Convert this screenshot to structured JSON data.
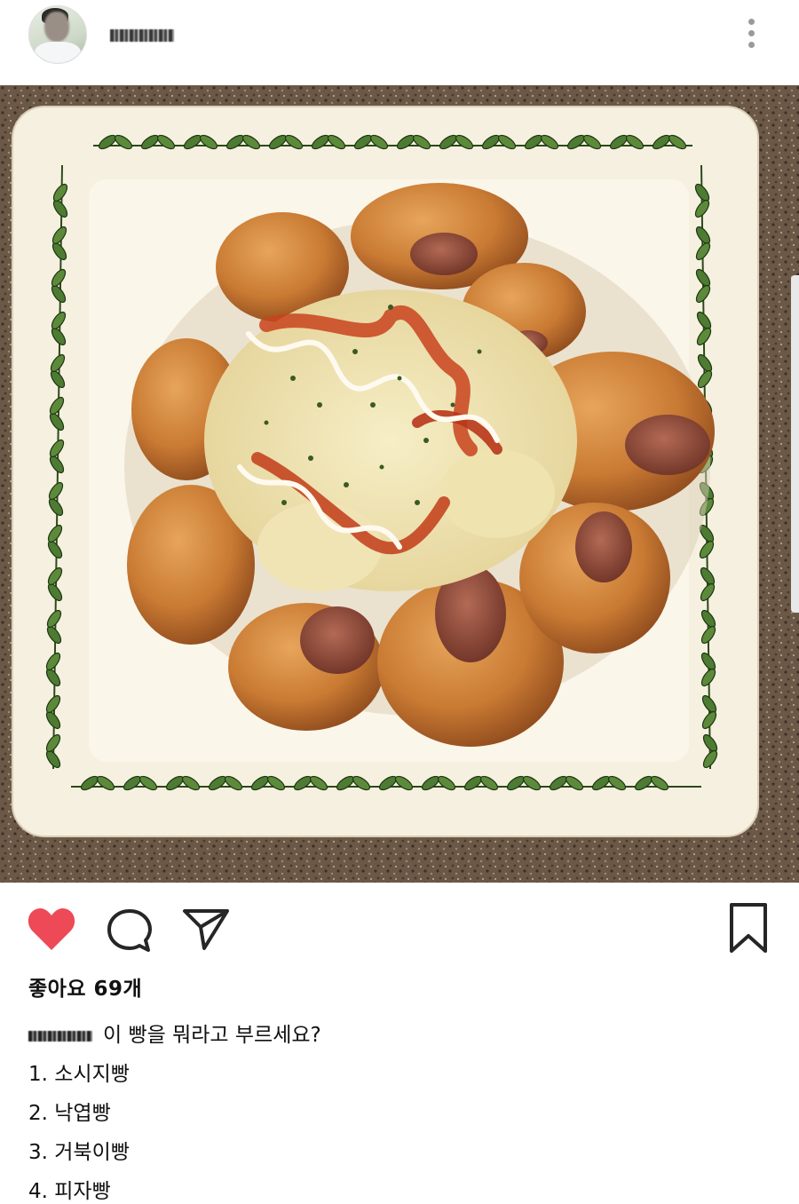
{
  "post": {
    "likes_text": "좋아요 69개",
    "caption_text": "이 빵을 뭐라고 부르세요?",
    "options": [
      "1. 소시지빵",
      "2. 낙엽빵",
      "3. 거북이빵",
      "4. 피자빵"
    ]
  },
  "icons": {
    "header": [
      "avatar",
      "more-vertical-icon"
    ],
    "actions": [
      "heart-icon",
      "comment-icon",
      "share-icon",
      "bookmark-icon"
    ]
  },
  "colors": {
    "heart": "#ed4956",
    "icon_stroke": "#262626",
    "more_dots": "#9a9a9a"
  }
}
